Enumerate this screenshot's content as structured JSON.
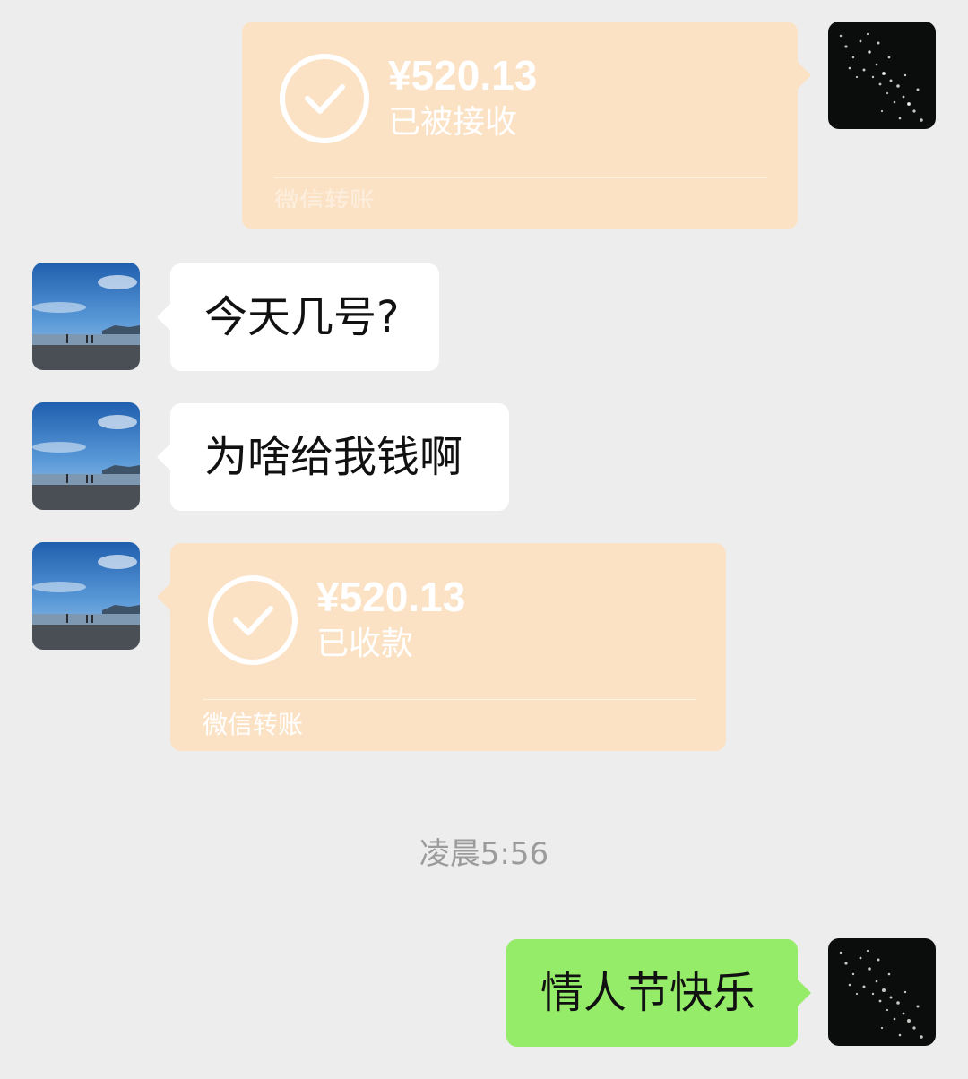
{
  "messages": {
    "transfer_sent": {
      "amount": "¥520.13",
      "status": "已被接收",
      "source": "微信转账"
    },
    "question_date": {
      "text": "今天几号?"
    },
    "question_money": {
      "text": "为啥给我钱啊"
    },
    "transfer_received": {
      "amount": "¥520.13",
      "status": "已收款",
      "source": "微信转账"
    },
    "timestamp": "凌晨5:56",
    "greeting": {
      "text": "情人节快乐"
    }
  },
  "colors": {
    "background": "#ededed",
    "white_bubble": "#ffffff",
    "green_bubble": "#95ec69",
    "transfer_bubble": "#fce2c5",
    "timestamp": "#9b9b9b"
  },
  "icons": {
    "contact_avatar": "beach-avatar-icon",
    "own_avatar": "night-city-avatar-icon",
    "transfer_status": "check-circle-icon"
  }
}
